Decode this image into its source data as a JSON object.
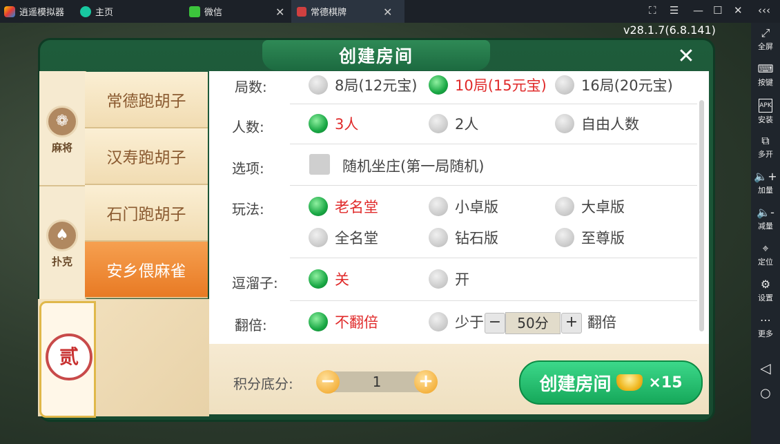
{
  "emulator": {
    "app_name": "逍遥模拟器",
    "tabs": [
      {
        "label": "主页"
      },
      {
        "label": "微信"
      },
      {
        "label": "常德棋牌"
      }
    ],
    "version": "v28.1.7(6.8.141)",
    "sidebar": [
      {
        "icon": "fullscreen-icon",
        "label": "全屏"
      },
      {
        "icon": "keyboard-icon",
        "label": "按键"
      },
      {
        "icon": "apk-icon",
        "label": "安装"
      },
      {
        "icon": "multi-instance-icon",
        "label": "多开"
      },
      {
        "icon": "volume-up-icon",
        "label": "加量"
      },
      {
        "icon": "volume-down-icon",
        "label": "减量"
      },
      {
        "icon": "location-icon",
        "label": "定位"
      },
      {
        "icon": "gear-icon",
        "label": "设置"
      },
      {
        "icon": "more-icon",
        "label": "更多"
      }
    ]
  },
  "dialog": {
    "title": "创建房间",
    "categories": [
      {
        "label": "麻将"
      },
      {
        "label": "扑克"
      }
    ],
    "badge": "贰",
    "games": [
      {
        "label": "常德跑胡子"
      },
      {
        "label": "汉寿跑胡子"
      },
      {
        "label": "石门跑胡子"
      },
      {
        "label": "安乡偎麻雀"
      }
    ],
    "rows": {
      "rounds": {
        "label": "局数:",
        "options": [
          "8局(12元宝)",
          "10局(15元宝)",
          "16局(20元宝)"
        ],
        "selected": 1
      },
      "players": {
        "label": "人数:",
        "options": [
          "3人",
          "2人",
          "自由人数"
        ],
        "selected": 0
      },
      "extras": {
        "label": "选项:",
        "checkbox": "随机坐庄(第一局随机)",
        "checked": false
      },
      "style": {
        "label": "玩法:",
        "options": [
          "老名堂",
          "小卓版",
          "大卓版",
          "全名堂",
          "钻石版",
          "至尊版"
        ],
        "selected": 0
      },
      "liuzi": {
        "label": "逗溜子:",
        "options": [
          "关",
          "开"
        ],
        "selected": 0
      },
      "double": {
        "label": "翻倍:",
        "options": [
          "不翻倍",
          "少于",
          "翻倍"
        ],
        "selected": 0,
        "threshold": "50分"
      }
    },
    "score": {
      "label": "积分底分:",
      "value": "1"
    },
    "create": {
      "label": "创建房间",
      "cost": "×15"
    }
  }
}
